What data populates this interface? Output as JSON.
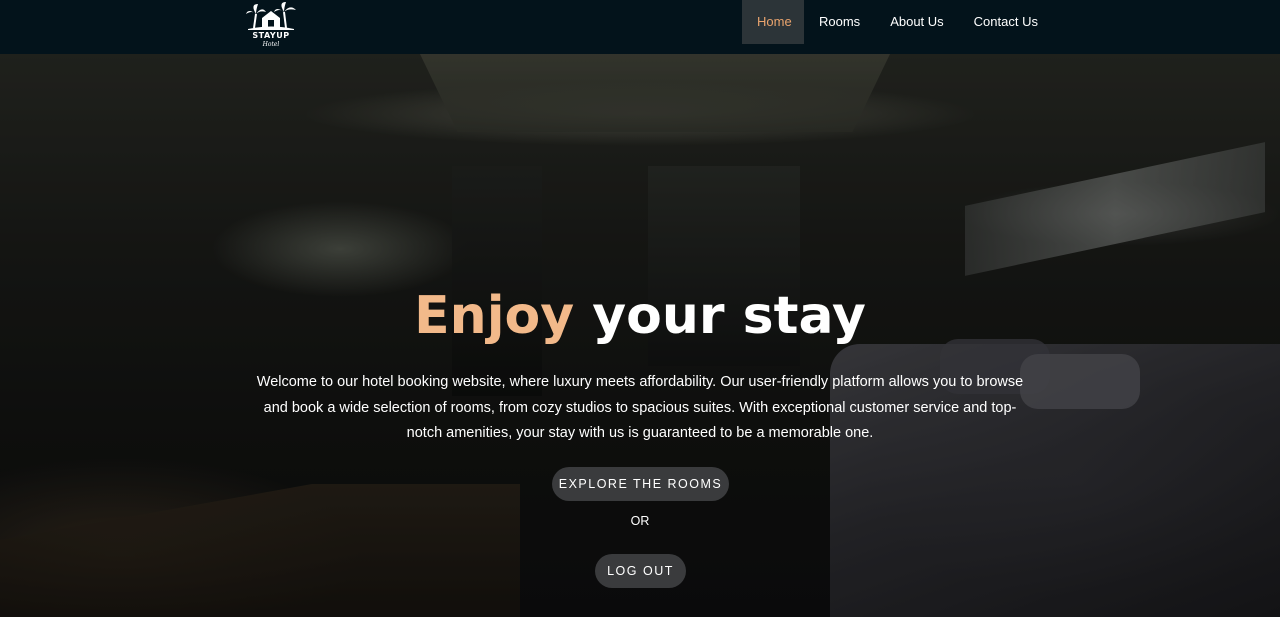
{
  "brand": {
    "name": "STAYUP",
    "subtitle": "Hotel"
  },
  "nav": {
    "items": [
      {
        "label": "Home",
        "active": true
      },
      {
        "label": "Rooms",
        "active": false
      },
      {
        "label": "About Us",
        "active": false
      },
      {
        "label": "Contact Us",
        "active": false
      }
    ]
  },
  "hero": {
    "title_accent": "Enjoy",
    "title_rest": " your stay",
    "description": "Welcome to our hotel booking website, where luxury meets affordability. Our user-friendly platform allows you to browse and book a wide selection of rooms, from cozy studios to spacious suites. With exceptional customer service and top-notch amenities, your stay with us is guaranteed to be a memorable one.",
    "explore_label": "EXPLORE THE ROOMS",
    "or_label": "OR",
    "logout_label": "LOG OUT"
  },
  "colors": {
    "navbar_bg": "#03131b",
    "accent": "#f2b98a",
    "active_link": "#e9a36d",
    "button_bg": "#3a3b3d"
  },
  "icons": {
    "logo": "palm-tree-house-logo-icon"
  }
}
